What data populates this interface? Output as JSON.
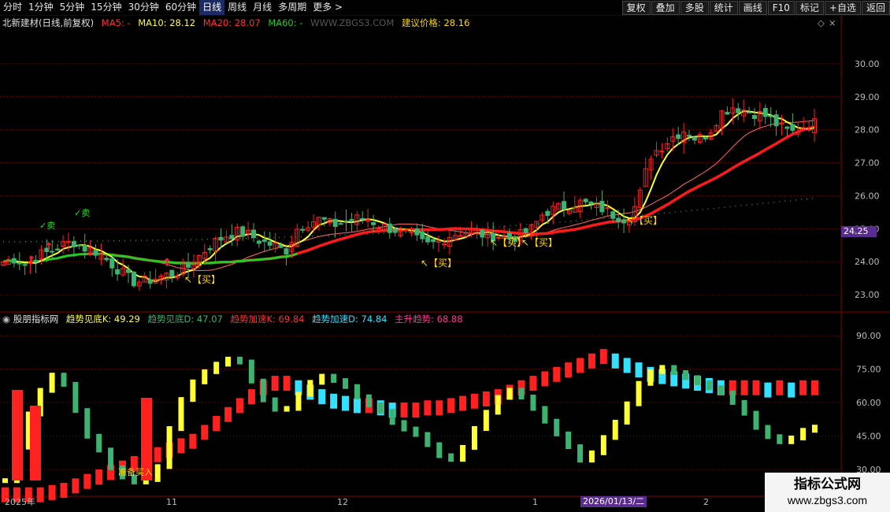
{
  "toolbar": {
    "periods": [
      "分时",
      "1分钟",
      "5分钟",
      "15分钟",
      "30分钟",
      "60分钟",
      "日线",
      "周线",
      "月线",
      "多周期",
      "更多 >"
    ],
    "active": "日线",
    "actions": [
      "复权",
      "叠加",
      "多股",
      "统计",
      "画线",
      "F10",
      "标记",
      "+自选",
      "返回"
    ]
  },
  "main_header": {
    "stock": "北新建材(日线,前复权)",
    "ma5": "MA5: -",
    "ma10": "MA10: 28.12",
    "ma20": "MA20: 28.07",
    "ma60": "MA60: -",
    "site": "WWW.ZBGS3.COM",
    "suggest": "建议价格: 28.16",
    "price_tag": "24.25"
  },
  "sub_header": {
    "name": "股朋指标网",
    "k1": "趋势见底K: 49.29",
    "d1": "趋势见底D: 47.07",
    "k2": "趋势加速K: 69.84",
    "d2": "趋势加速D: 74.84",
    "main": "主升趋势: 68.88"
  },
  "date_axis": {
    "labels": [
      "2025年",
      "11",
      "12",
      "1",
      "2"
    ],
    "cursor": "2026/01/13/二"
  },
  "signals": {
    "buy": "【买】",
    "sell": "卖",
    "prepare_buy": "准备买入"
  },
  "watermark": {
    "title": "指标公式网",
    "url": "www.zbgs3.com"
  },
  "colors": {
    "up": "#ff2020",
    "down": "#3cb371",
    "ma_yellow": "#ffff33",
    "ma_green": "#22cc22",
    "ma_red": "#ff1a1a",
    "cyan": "#33e0ff",
    "grid": "#7a0000"
  },
  "chart_data": [
    {
      "type": "candlestick",
      "title": "北新建材(日线,前复权)",
      "ylim": [
        22.5,
        31.0
      ],
      "y_ticks": [
        23.0,
        24.0,
        25.0,
        26.0,
        27.0,
        28.0,
        29.0,
        30.0
      ],
      "x_labels": [
        "2025年",
        "11",
        "12",
        "1",
        "2"
      ],
      "close_path": [
        24.0,
        24.1,
        23.9,
        24.2,
        24.3,
        24.5,
        24.6,
        24.4,
        24.3,
        24.0,
        23.7,
        23.4,
        23.4,
        23.5,
        23.6,
        23.7,
        23.9,
        24.3,
        24.6,
        24.8,
        24.9,
        24.8,
        24.6,
        24.5,
        24.3,
        25.0,
        25.2,
        25.3,
        25.1,
        25.2,
        25.3,
        25.3,
        25.1,
        25.0,
        24.9,
        24.7,
        24.5,
        24.6,
        24.8,
        24.9,
        24.9,
        24.8,
        24.8,
        24.7,
        24.8,
        25.0,
        25.5,
        25.6,
        25.7,
        25.8,
        25.7,
        25.6,
        25.4,
        25.3,
        25.8,
        27.2,
        27.5,
        27.8,
        28.0,
        27.7,
        27.9,
        28.5,
        28.7,
        28.6,
        28.5,
        28.4,
        28.1,
        27.9,
        28.1,
        28.2
      ],
      "series": [
        {
          "name": "MA10",
          "last": 28.12
        },
        {
          "name": "MA20",
          "last": 28.07
        }
      ],
      "price_tag": 24.25
    },
    {
      "type": "bar",
      "title": "股朋指标网",
      "ylim": [
        18,
        95
      ],
      "y_ticks": [
        30.0,
        45.0,
        60.0,
        75.0,
        90.0
      ],
      "series": [
        {
          "name": "趋势见底K",
          "last": 49.29,
          "values": [
            25,
            38,
            52,
            62,
            70,
            74,
            66,
            55,
            45,
            40,
            32,
            28,
            25,
            24,
            26,
            32,
            48,
            60,
            68,
            72,
            76,
            78,
            80,
            78,
            70,
            62,
            58,
            55,
            60,
            66,
            70,
            72,
            70,
            68,
            64,
            60,
            58,
            55,
            50,
            48,
            46,
            42,
            38,
            33,
            36,
            42,
            50,
            56,
            62,
            66,
            64,
            60,
            55,
            50,
            45,
            40,
            34,
            36,
            42,
            48,
            54,
            62,
            70,
            74,
            76,
            74,
            72,
            70,
            68,
            66,
            64,
            60,
            56,
            50,
            46,
            43,
            42,
            45,
            48,
            49
          ]
        },
        {
          "name": "趋势见底D",
          "last": 47.07
        },
        {
          "name": "趋势加速K",
          "last": 69.84,
          "values": [
            22,
            22,
            22,
            22,
            23,
            24,
            26,
            28,
            30,
            32,
            34,
            36,
            38,
            40,
            42,
            44,
            46,
            50,
            54,
            58,
            62,
            66,
            70,
            72,
            72,
            70,
            68,
            66,
            64,
            63,
            62,
            62,
            61,
            60,
            60,
            60,
            61,
            61,
            62,
            63,
            64,
            65,
            66,
            68,
            70,
            72,
            74,
            76,
            78,
            80,
            82,
            84,
            82,
            80,
            78,
            76,
            75,
            74,
            73,
            72,
            71,
            70,
            70,
            70,
            70,
            69,
            70,
            69,
            70,
            70
          ]
        },
        {
          "name": "趋势加速D",
          "last": 74.84
        },
        {
          "name": "主升趋势",
          "last": 68.88
        }
      ]
    }
  ]
}
